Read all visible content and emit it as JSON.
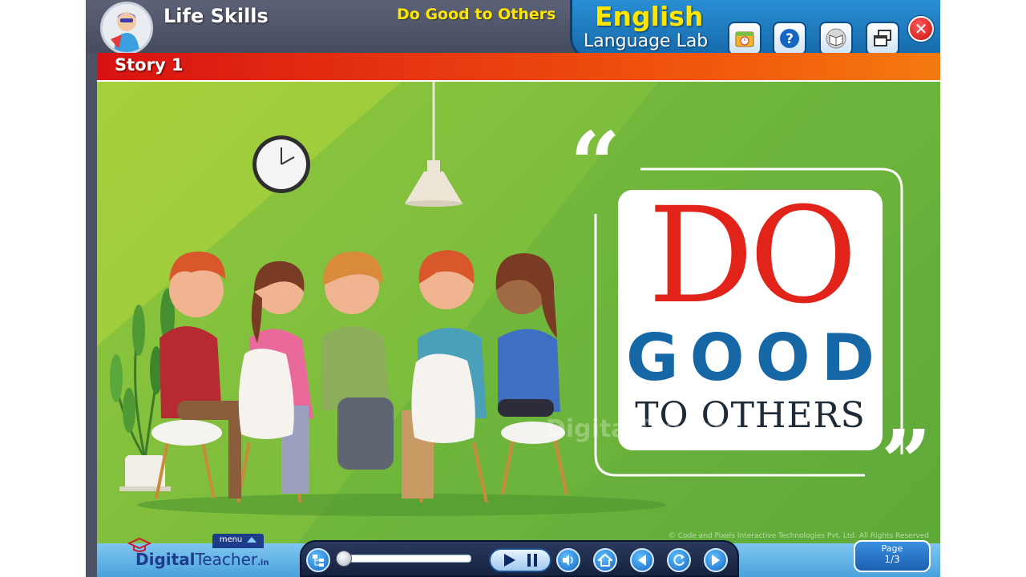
{
  "header": {
    "app_title": "Life Skills",
    "topic_title": "Do Good to Others",
    "brand_line1": "English",
    "brand_line2": "Language Lab"
  },
  "toolbar": {
    "buttons": [
      {
        "name": "index-button",
        "icon": "clock-book-icon"
      },
      {
        "name": "help-button",
        "icon": "question-icon"
      },
      {
        "name": "glossary-button",
        "icon": "book-icon"
      },
      {
        "name": "fullscreen-button",
        "icon": "windows-icon"
      }
    ],
    "close_icon": "close-icon"
  },
  "story_bar": {
    "label": "Story 1"
  },
  "poster": {
    "open_quote": "“",
    "close_quote": "”",
    "do": "DO",
    "good_letters": [
      "G",
      "O",
      "O",
      "D"
    ],
    "to_others": "TO OTHERS",
    "colors": {
      "do": "#e1231a",
      "good": "#1567a6",
      "others": "#1f2a37"
    }
  },
  "watermark": {
    "text": "DigitalTeacher",
    "suffix": ".in"
  },
  "copyright": "© Code and Pixels Interactive Technologies  Pvt. Ltd. All Rights Reserved",
  "footer": {
    "logo_part1": "Digital",
    "logo_part2": "Teacher",
    "logo_part3": ".in",
    "menu_label": "menu",
    "page_label": "Page",
    "page_number": "1/3",
    "seek_progress": 0.0
  },
  "player": {
    "controls": [
      "sitemap-icon",
      "play-icon",
      "pause-icon",
      "volume-icon",
      "home-icon",
      "previous-icon",
      "replay-icon",
      "next-icon"
    ]
  },
  "theme": {
    "topbar": "#4d5366",
    "accent_red": "#e1231a",
    "scene_green": "#7dbd3d",
    "title_yellow": "#ffe600"
  }
}
